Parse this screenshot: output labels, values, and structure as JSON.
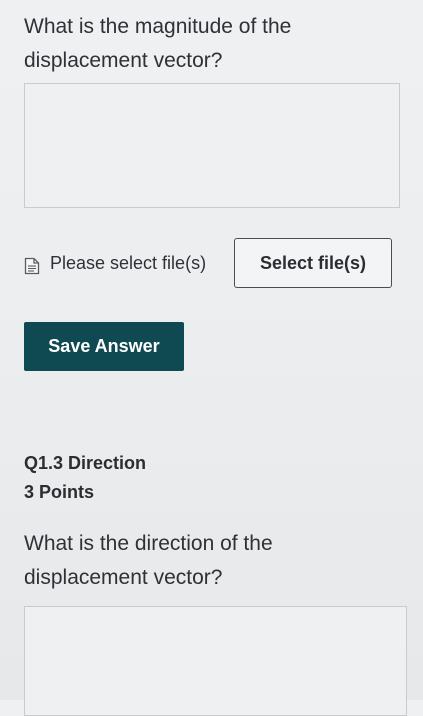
{
  "question1": {
    "prompt": "What is the magnitude of the displacement vector?",
    "answer_value": ""
  },
  "file_upload": {
    "icon": "document-icon",
    "label": "Please select file(s)",
    "button_label": "Select file(s)"
  },
  "save_button": {
    "label": "Save Answer",
    "color": "#0f4a52"
  },
  "question2": {
    "heading": "Q1.3 Direction",
    "points": "3 Points",
    "prompt": "What is the direction of the displacement vector?",
    "answer_value": ""
  }
}
